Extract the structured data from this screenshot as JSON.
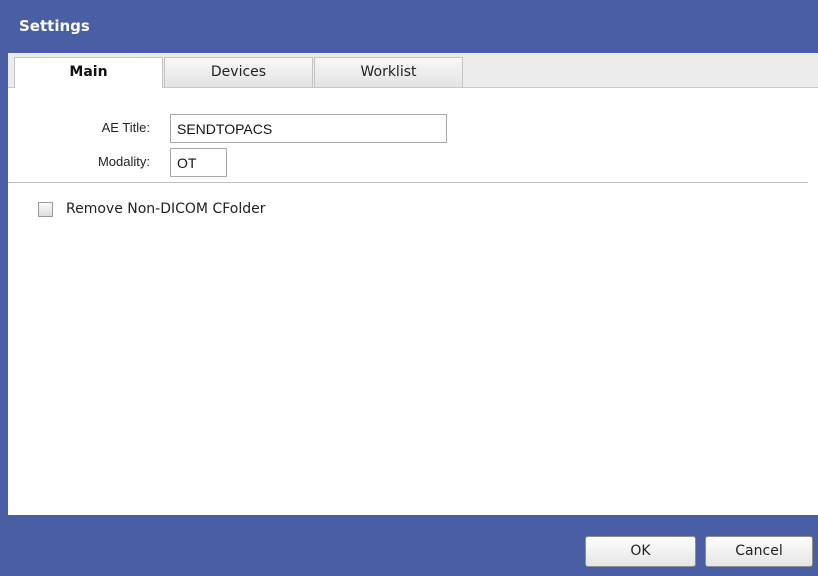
{
  "window": {
    "title": "Settings"
  },
  "tabs": [
    {
      "label": "Main",
      "active": true
    },
    {
      "label": "Devices",
      "active": false
    },
    {
      "label": "Worklist",
      "active": false
    }
  ],
  "main": {
    "ae_title": {
      "label": "AE Title:",
      "value": "SENDTOPACS"
    },
    "modality": {
      "label": "Modality:",
      "value": "OT"
    },
    "remove_non_dicom": {
      "label": "Remove Non-DICOM CFolder",
      "checked": false
    }
  },
  "footer": {
    "ok_label": "OK",
    "cancel_label": "Cancel"
  },
  "colors": {
    "title_bar": "#4a5fa3",
    "content_bg": "#ffffff"
  }
}
